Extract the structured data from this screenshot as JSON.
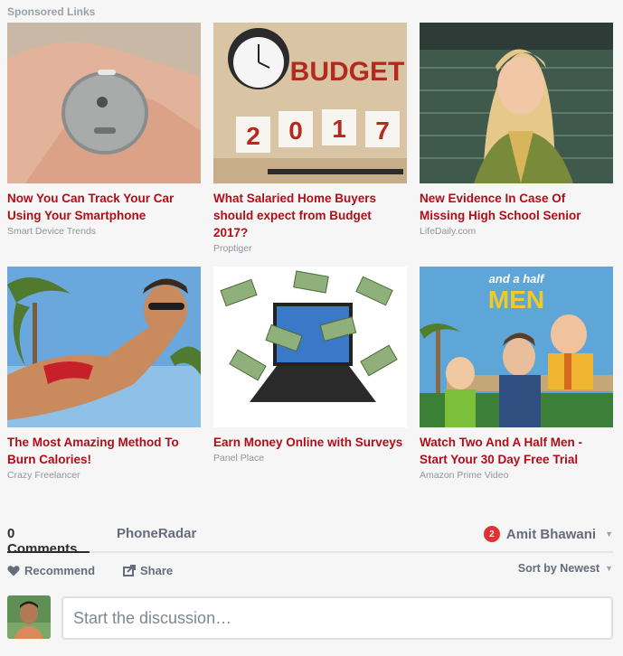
{
  "sponsored": {
    "label": "Sponsored Links",
    "items": [
      {
        "title": "Now You Can Track Your Car Using Your Smartphone",
        "source": "Smart Device Trends",
        "image": "hand-holding-tracker"
      },
      {
        "title": "What Salaried Home Buyers should expect from Budget 2017?",
        "source": "Proptiger",
        "image": "budget-2017-clock",
        "image_text": [
          "BUDGET",
          "2",
          "0",
          "1",
          "7"
        ]
      },
      {
        "title": "New Evidence In Case Of Missing High School Senior",
        "source": "LifeDaily.com",
        "image": "smiling-girl-portrait"
      },
      {
        "title": "The Most Amazing Method To Burn Calories!",
        "source": "Crazy Freelancer",
        "image": "woman-bikini-palm-trees"
      },
      {
        "title": "Earn Money Online with Surveys",
        "source": "Panel Place",
        "image": "laptop-flying-money"
      },
      {
        "title": "Watch Two And A Half Men - Start Your 30 Day Free Trial",
        "source": "Amazon Prime Video",
        "image": "two-and-a-half-men-poster",
        "image_text": [
          "and a half",
          "MEN"
        ]
      }
    ]
  },
  "comments": {
    "count_label": "0 Comments",
    "community_label": "PhoneRadar",
    "notification_count": "2",
    "user_name": "Amit Bhawani",
    "recommend_label": "Recommend",
    "share_label": "Share",
    "sort_label": "Sort by Newest",
    "composer_placeholder": "Start the discussion…"
  },
  "colors": {
    "title_red": "#b10d17",
    "badge_red": "#e2322f",
    "muted_text": "#656c7a"
  }
}
